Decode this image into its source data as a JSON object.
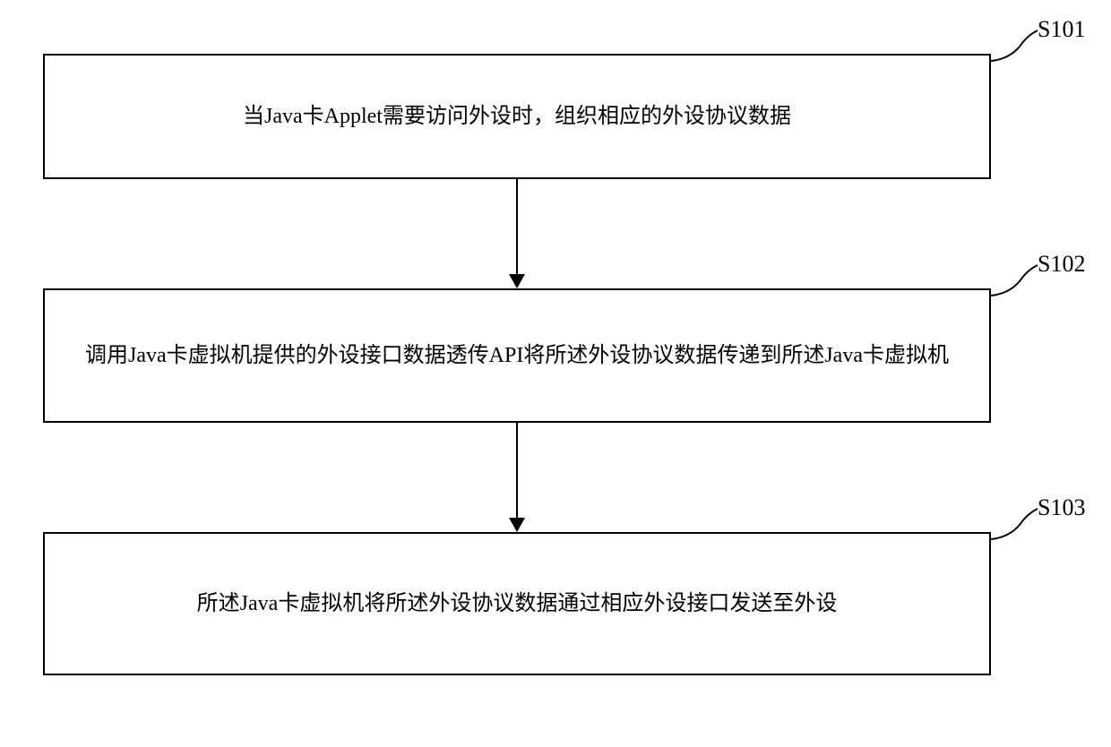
{
  "steps": [
    {
      "label": "S101",
      "text": "当Java卡Applet需要访问外设时，组织相应的外设协议数据"
    },
    {
      "label": "S102",
      "text": "调用Java卡虚拟机提供的外设接口数据透传API将所述外设协议数据传递到所述Java卡虚拟机"
    },
    {
      "label": "S103",
      "text": "所述Java卡虚拟机将所述外设协议数据通过相应外设接口发送至外设"
    }
  ]
}
